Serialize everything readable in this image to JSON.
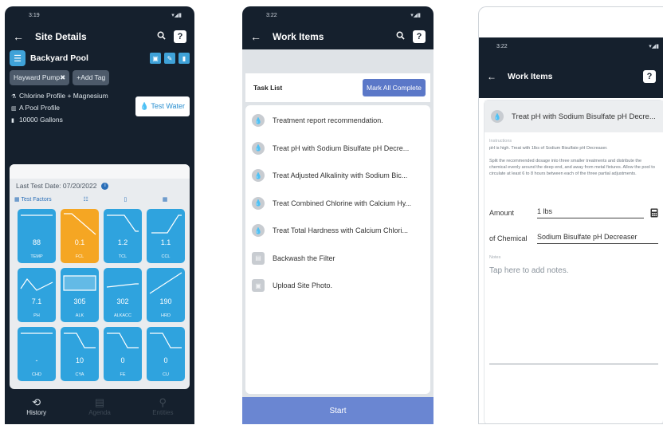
{
  "phone1": {
    "status": {
      "time": "3:19",
      "icons": "▾◢▮"
    },
    "appbar": {
      "title": "Site Details",
      "back": "←",
      "help": "?"
    },
    "site": {
      "name": "Backyard Pool"
    },
    "tags": [
      {
        "label": "Hayward Pump✖"
      },
      {
        "label": "+Add Tag"
      }
    ],
    "info": {
      "profile": "Chlorine Profile + Magnesium",
      "pool_profile": "A Pool Profile",
      "volume": "10000 Gallons"
    },
    "test_water_label": "Test Water",
    "last_test": "Last Test Date: 07/20/2022",
    "tabs": {
      "test_factors": "Test Factors"
    },
    "tiles": [
      {
        "value": "88",
        "label": "TEMP",
        "color": "#2fa3de"
      },
      {
        "value": "0.1",
        "label": "FCL",
        "color": "#f5a623"
      },
      {
        "value": "1.2",
        "label": "TCL",
        "color": "#2fa3de"
      },
      {
        "value": "1.1",
        "label": "CCL",
        "color": "#2fa3de"
      },
      {
        "value": "7.1",
        "label": "PH",
        "color": "#2fa3de"
      },
      {
        "value": "305",
        "label": "ALK",
        "color": "#2fa3de"
      },
      {
        "value": "302",
        "label": "ALKACC",
        "color": "#2fa3de"
      },
      {
        "value": "190",
        "label": "HRD",
        "color": "#2fa3de"
      },
      {
        "value": "-",
        "label": "CHD",
        "color": "#2fa3de"
      },
      {
        "value": "10",
        "label": "CYA",
        "color": "#2fa3de"
      },
      {
        "value": "0",
        "label": "FE",
        "color": "#2fa3de"
      },
      {
        "value": "0",
        "label": "CU",
        "color": "#2fa3de"
      }
    ],
    "nav": [
      {
        "label": "History",
        "icon": "⟲"
      },
      {
        "label": "Agenda",
        "icon": "▤"
      },
      {
        "label": "Entities",
        "icon": "⚲"
      }
    ]
  },
  "phone2": {
    "status": {
      "time": "3:22",
      "icons": "▾◢▮"
    },
    "appbar": {
      "title": "Work Items",
      "back": "←",
      "help": "?"
    },
    "task_list_label": "Task List",
    "mark_all_label": "Mark All Complete",
    "tasks": [
      {
        "text": "Treatment report recommendation.",
        "icon": "drop"
      },
      {
        "text": "Treat pH with Sodium Bisulfate pH Decre...",
        "icon": "drop"
      },
      {
        "text": "Treat Adjusted Alkalinity with Sodium Bic...",
        "icon": "drop"
      },
      {
        "text": "Treat Combined Chlorine with Calcium Hy...",
        "icon": "drop"
      },
      {
        "text": "Treat Total Hardness with Calcium Chlori...",
        "icon": "drop"
      },
      {
        "text": "Backwash the Filter",
        "icon": "filter"
      },
      {
        "text": "Upload Site Photo.",
        "icon": "photo"
      }
    ],
    "start_label": "Start"
  },
  "phone3": {
    "status": {
      "time": "3:22",
      "icons": "▾◢▮"
    },
    "appbar": {
      "title": "Work Items",
      "back": "←",
      "help": "?"
    },
    "item_title": "Treat pH with Sodium Bisulfate pH Decre...",
    "instructions_label": "Instructions",
    "instruction_1": "pH is high. Treat with 1lbs of Sodium Bisulfate pH Decreaser.",
    "instruction_2": "Split the recommended dosage into three smaller treatments and distribute the chemical evenly around the deep end, and away from metal fixtures. Allow the pool to circulate at least 6 to 8 hours between each of the three partial adjustments.",
    "amount_label": "Amount",
    "amount_value": "1 lbs",
    "chemical_label": "of Chemical",
    "chemical_value": "Sodium Bisulfate pH Decreaser",
    "notes_label": "Notes",
    "notes_placeholder": "Tap here to add notes."
  }
}
